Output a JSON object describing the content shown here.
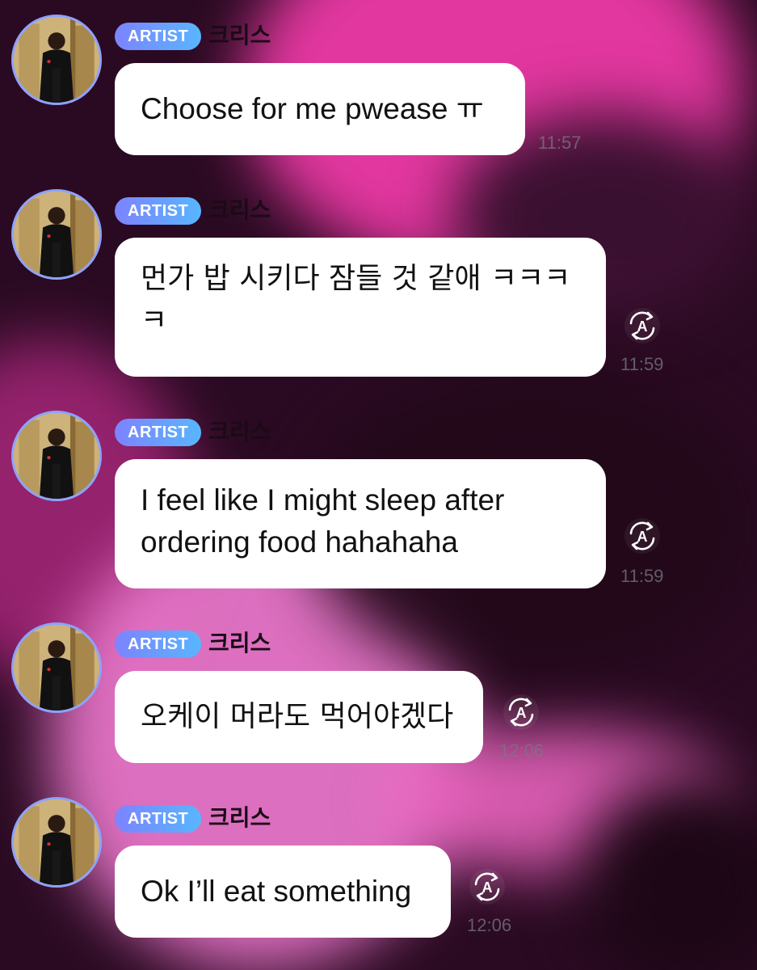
{
  "messages": [
    {
      "badge": "ARTIST",
      "sender": "크리스",
      "text": "Choose for me pwease ㅠ",
      "time": "11:57",
      "translate_icon": false
    },
    {
      "badge": "ARTIST",
      "sender": "크리스",
      "text": "먼가 밥 시키다 잠들 것 같애 ㅋㅋㅋ\nㅋ",
      "time": "11:59",
      "translate_icon": true
    },
    {
      "badge": "ARTIST",
      "sender": "크리스",
      "text": "I feel like I might sleep after\nordering food hahahaha",
      "time": "11:59",
      "translate_icon": true
    },
    {
      "badge": "ARTIST",
      "sender": "크리스",
      "text": "오케이 머라도 먹어야겠다",
      "time": "12:06",
      "translate_icon": true
    },
    {
      "badge": "ARTIST",
      "sender": "크리스",
      "text": "Ok I’ll eat something",
      "time": "12:06",
      "translate_icon": true
    }
  ],
  "colors": {
    "badge_start": "#7d83ff",
    "badge_end": "#58b6ff",
    "bubble": "#ffffff",
    "avatar_ring": "#8ea2ff",
    "background": "#2a0a22",
    "highlight": "#e23aa6"
  },
  "icons": {
    "translate": "translate-icon"
  }
}
